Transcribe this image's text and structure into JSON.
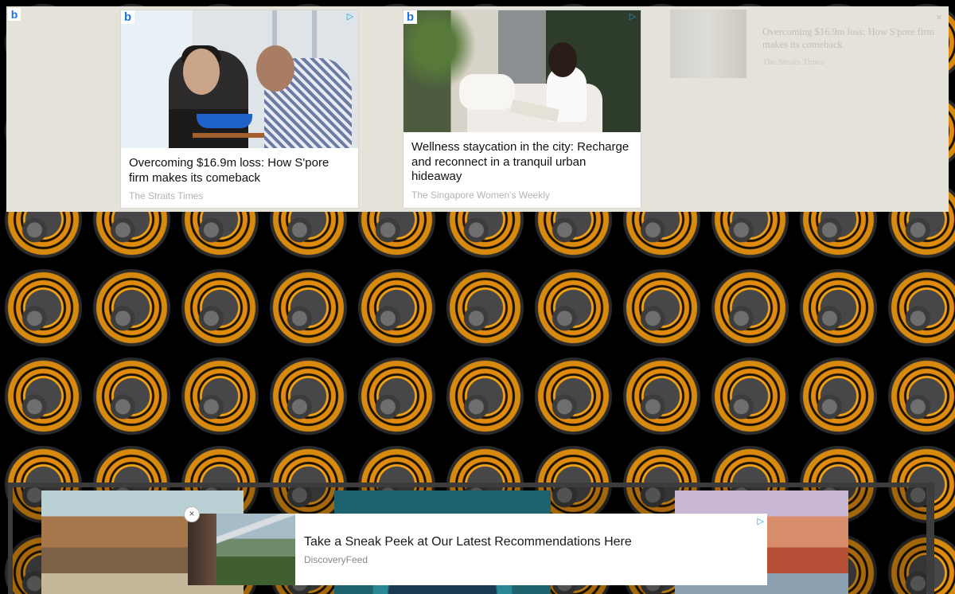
{
  "top_ads": {
    "corner_logo": "b",
    "cards": [
      {
        "logo": "b",
        "adchoice": "▷",
        "title": "Overcoming $16.9m loss: How S'pore firm makes its comeback",
        "source": "The Straits Times"
      },
      {
        "logo": "b",
        "adchoice": "▷",
        "title": "Wellness staycation in the city: Recharge and reconnect in a tranquil urban hideaway",
        "source": "The Singapore Women's Weekly"
      }
    ],
    "faded_card": {
      "title": "Overcoming $16.9m loss: How S'pore firm makes its comeback",
      "source": "The Straits Times",
      "close": "×"
    }
  },
  "sticky_ad": {
    "close": "×",
    "adchoice": "▷",
    "title": "Take a Sneak Peek at Our Latest Recommendations Here",
    "source": "DiscoveryFeed"
  },
  "colors": {
    "page_background": "#000000",
    "pattern_orange": "#f0a21a",
    "banner_background": "#e5e2da",
    "adchoice_blue": "#1a9ad6"
  }
}
